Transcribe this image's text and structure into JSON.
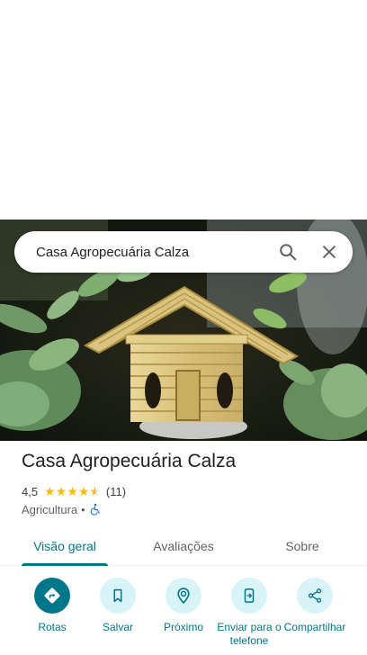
{
  "search": {
    "query": "Casa Agropecuária Calza"
  },
  "place": {
    "name": "Casa Agropecuária Calza",
    "rating": "4,5",
    "rating_value": 4.5,
    "review_count": "(11)",
    "category": "Agricultura",
    "separator": "•"
  },
  "tabs": [
    {
      "label": "Visão geral",
      "active": true
    },
    {
      "label": "Avaliações",
      "active": false
    },
    {
      "label": "Sobre",
      "active": false
    }
  ],
  "actions": [
    {
      "label": "Rotas",
      "icon": "directions-icon"
    },
    {
      "label": "Salvar",
      "icon": "bookmark-icon"
    },
    {
      "label": "Próximo",
      "icon": "nearby-icon"
    },
    {
      "label": "Enviar para o telefone",
      "icon": "send-to-phone-icon"
    },
    {
      "label": "Compartilhar",
      "icon": "share-icon"
    }
  ],
  "colors": {
    "accent": "#00768a",
    "accent_light": "#d8f4f8",
    "star": "#fbbc04"
  }
}
